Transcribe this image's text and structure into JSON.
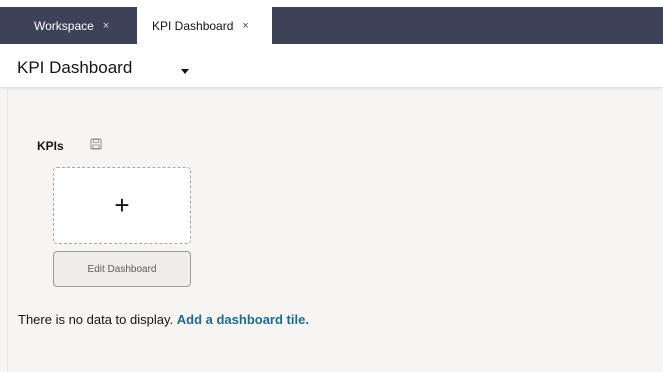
{
  "tabs": [
    {
      "label": "Workspace",
      "close": "×",
      "active": false
    },
    {
      "label": "KPI Dashboard",
      "close": "×",
      "active": true
    }
  ],
  "header": {
    "title": "KPI Dashboard",
    "dropdown_icon": "chevron-down-icon"
  },
  "kpis": {
    "title": "KPIs",
    "save_icon": "save-icon",
    "add_tile_symbol": "+",
    "edit_button_label": "Edit Dashboard"
  },
  "empty_state": {
    "message": "There is no data to display.",
    "link_text": "Add a dashboard tile."
  },
  "colors": {
    "tabbar_bg": "#3e4259",
    "page_bg": "#f6f5f4",
    "link": "#1e6a8f"
  }
}
